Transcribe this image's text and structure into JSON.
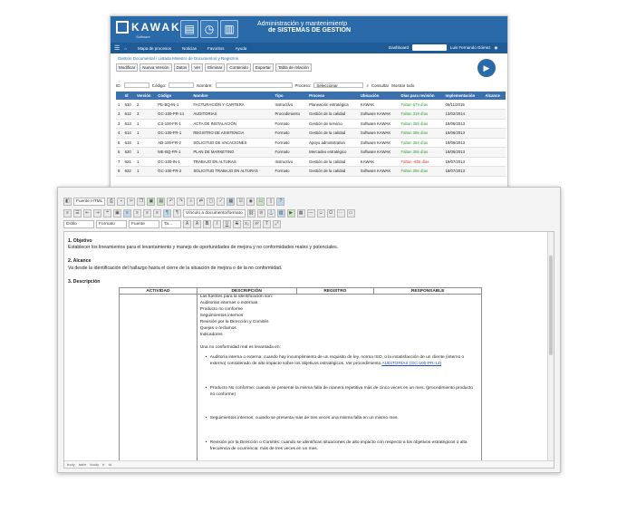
{
  "back_window": {
    "logo_text": "KAWAK",
    "logo_subtext": "Software",
    "banner_title_line1": "Administración y mantenimiento",
    "banner_title_line2": "de SISTEMAS DE GESTIÓN",
    "nav": {
      "items": [
        "Mapa de procesos",
        "Noticias",
        "Favoritos",
        "Ayuda"
      ],
      "dashboard_label": "Dashboard",
      "user_name": "Luis Fernando Gómez"
    },
    "breadcrumb": "Gestión Documental / Listado Maestro de Documentos y Registros",
    "action_buttons": [
      "Modificar",
      "Nueva Versión",
      "Datos",
      "Ver",
      "Eliminar",
      "Contenido",
      "Exportar",
      "Tabla de relación"
    ],
    "filters": {
      "id_label": "ID:",
      "code_label": "Código:",
      "name_label": "Nombre:",
      "process_label": "Proceso:",
      "process_value": "Seleccionar",
      "consult_label": "Consultar",
      "show_all_label": "Mostrar todo"
    },
    "table": {
      "headers": [
        "Id",
        "Versión",
        "Código",
        "Nombre",
        "Tipo",
        "Proceso",
        "Ubicación",
        "Días para revisión",
        "Implementación",
        "Alcance"
      ],
      "rows": [
        [
          "1",
          "610",
          "2",
          "PE-BQ-IN-1",
          "FACTURACIÓN Y CARTERA",
          "Instructivo",
          "Planeación estratégica",
          "KAWAK",
          "Faltan 679 días",
          "06/11/2015"
        ],
        [
          "2",
          "612",
          "3",
          "GC-100-PR-14",
          "AUDITORIAS",
          "Procedimiento",
          "Gestión de la calidad",
          "Software KAWAK",
          "Faltan 319 días",
          "13/02/2014"
        ],
        [
          "3",
          "613",
          "1",
          "CS-100-FR-1",
          "ACTA DE INSTALACIÓN",
          "Formato",
          "Gestión de servicio",
          "Software KAWAK",
          "Faltan 355 días",
          "18/06/2013"
        ],
        [
          "4",
          "614",
          "1",
          "GC-100-FR-1",
          "REGISTRO DE ASISTENCIA",
          "Formato",
          "Gestión de la calidad",
          "Software KAWAK",
          "Faltan 355 días",
          "18/06/2013"
        ],
        [
          "5",
          "618",
          "1",
          "AD-100-FR-2",
          "SOLICITUD DE VACACIONES",
          "Formato",
          "Apoyo administrativo",
          "Software KAWAK",
          "Faltan 353 días",
          "18/06/2013"
        ],
        [
          "6",
          "620",
          "1",
          "ME-BQ-FR-1",
          "PLAN DE MARKETING",
          "Formato",
          "Mercadeo estratégico",
          "Software KAWAK",
          "Faltan 355 días",
          "18/06/2013"
        ],
        [
          "7",
          "621",
          "1",
          "GC-100-IN-1",
          "TRABAJO EN ALTURAS",
          "Instructivo",
          "Gestión de la calidad",
          "KAWAK",
          "Faltan -656 días",
          "19/07/2013"
        ],
        [
          "8",
          "622",
          "1",
          "GC-100-FR-2",
          "SOLICITUD TRABAJO EN ALTURAS",
          "Formato",
          "Gestión de la calidad",
          "Software KAWAK",
          "Faltan 355 días",
          "18/07/2013"
        ]
      ]
    }
  },
  "editor": {
    "source_button": "Fuente HTML",
    "link_dropdown": "Vínculo a documento/formato",
    "style_dropdown": "Estilo",
    "format_dropdown": "Formato",
    "font_dropdown": "Fuente",
    "size_dropdown": "Ta...",
    "statusbar_path": [
      "body",
      "table",
      "tbody",
      "tr",
      "td"
    ],
    "content": {
      "sec1_title": "1. Objetivo",
      "sec1_text": "Establecer los lineamientos para el levantamiento y manejo de oportunidades de mejora y no conformidades reales y potenciales.",
      "sec2_title": "2. Alcance",
      "sec2_text": "Va desde la identificación del hallazgo hasta el cierre de la situación de mejora o de la no conformidad.",
      "sec3_title": "3. Descripción",
      "table_headers": [
        "ACTIVIDAD",
        "DESCRIPCIÓN",
        "REGISTRO",
        "RESPONSABLE"
      ],
      "desc_lines": [
        "Las fuentes para la identificación son:",
        "Auditorias internas o externas",
        "Producto no conforme",
        "Seguimientos internos",
        "Revisión por la Dirección y Comités",
        "Quejas o reclamos",
        "Indicadores"
      ],
      "nc_intro": "Una no conformidad real es levantada en:",
      "bullet1_text": "Auditoría interna o externa: cuando hay incumplimiento de un requisito de ley, norma ISO, o la insatisfacción de un cliente (interno o externo) considerado de alto impacto sobre los objetivos estratégicos. Ver procedimiento",
      "bullet1_link": "AUDITORIAS (GC-100-PR-14)",
      "bullet2_text": "Producto No conforme: cuando se presente la misma falla de manera repetitiva más de cinco veces en un mes. (procedimiento producto no conforme)",
      "bullet3_text": "Seguimientos internos: cuando se presenta más de tres veces una misma falla en un mismo mes.",
      "bullet4_text": "Revisión por la Dirección o Comités: cuando se identifican situaciones de alto impacto con respecto a los objetivos estratégicos o alta frecuencia de ocurrencia: más de tres veces en un mes."
    }
  },
  "colors": {
    "brand_blue": "#2b6aa8",
    "nav_blue": "#1f5b96",
    "table_header": "#3a70ad",
    "ok_green": "#2e9e2e",
    "late_red": "#d33333",
    "link_blue": "#1f4fc0"
  }
}
